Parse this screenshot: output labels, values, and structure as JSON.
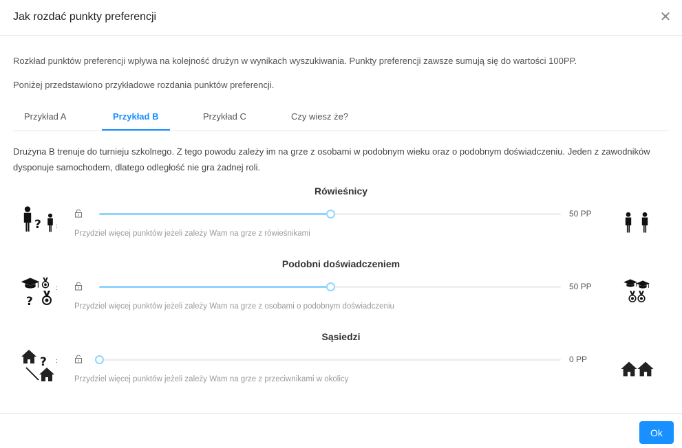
{
  "dialog": {
    "title": "Jak rozdać punkty preferencji",
    "close_icon": "close-icon"
  },
  "intro": {
    "p1": "Rozkład punktów preferencji wpływa na kolejność drużyn w wynikach wyszukiwania. Punkty preferencji zawsze sumują się do wartości 100PP.",
    "p2": "Poniżej przedstawiono przykładowe rozdania punktów preferencji."
  },
  "tabs": [
    {
      "label": "Przykład A",
      "active": false
    },
    {
      "label": "Przykład B",
      "active": true
    },
    {
      "label": "Przykład C",
      "active": false
    },
    {
      "label": "Czy wiesz że?",
      "active": false
    }
  ],
  "description": "Drużyna B trenuje do turnieju szkolnego. Z tego powodu zależy im na grze z osobami w podobnym wieku oraz o podobnym doświadczeniu. Jeden z zawodników dysponuje samochodem, dlatego odległość nie gra żadnej roli.",
  "sliders": [
    {
      "title": "Rówieśnicy",
      "value_label": "50 PP",
      "value": 50,
      "hint": "Przydziel więcej punktów jeżeli zależy Wam na grze z rówieśnikami",
      "left_icon": "peers-question-icon",
      "right_icon": "peers-icon"
    },
    {
      "title": "Podobni doświadczeniem",
      "value_label": "50 PP",
      "value": 50,
      "hint": "Przydziel więcej punktów jeżeli zależy Wam na grze z osobami o podobnym doświadczeniu",
      "left_icon": "experience-question-icon",
      "right_icon": "experience-icon"
    },
    {
      "title": "Sąsiedzi",
      "value_label": "0 PP",
      "value": 0,
      "hint": "Przydziel więcej punktów jeżeli zależy Wam na grze z przeciwnikami w okolicy",
      "left_icon": "neighbors-question-icon",
      "right_icon": "neighbors-icon"
    }
  ],
  "slider_max": 100,
  "colors": {
    "accent": "#1890ff",
    "slider": "#91d5ff"
  },
  "footer": {
    "ok_label": "Ok"
  }
}
